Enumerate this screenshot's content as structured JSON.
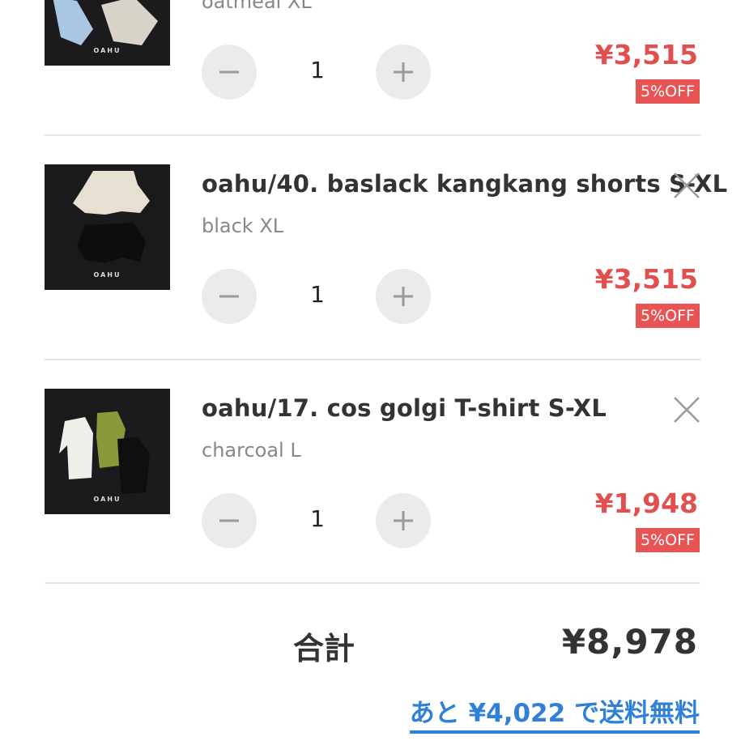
{
  "colors": {
    "price": "#e14f4f",
    "badge": "#e85454",
    "link": "#2f80d6"
  },
  "items": [
    {
      "name": "",
      "variant": "oatmeal XL",
      "quantity": "1",
      "price": "¥3,515",
      "discount": "5%OFF",
      "brand": "OAHU"
    },
    {
      "name": "oahu/40. baslack kangkang shorts S-XL",
      "variant": "black XL",
      "quantity": "1",
      "price": "¥3,515",
      "discount": "5%OFF",
      "brand": "OAHU"
    },
    {
      "name": "oahu/17. cos golgi T-shirt S-XL",
      "variant": "charcoal L",
      "quantity": "1",
      "price": "¥1,948",
      "discount": "5%OFF",
      "brand": "OAHU"
    }
  ],
  "summary": {
    "total_label": "合計",
    "total_value": "¥8,978",
    "free_shipping_text": "あと ¥4,022 で送料無料"
  },
  "icons": {
    "decrement": "minus-icon",
    "increment": "plus-icon",
    "remove": "close-icon"
  }
}
